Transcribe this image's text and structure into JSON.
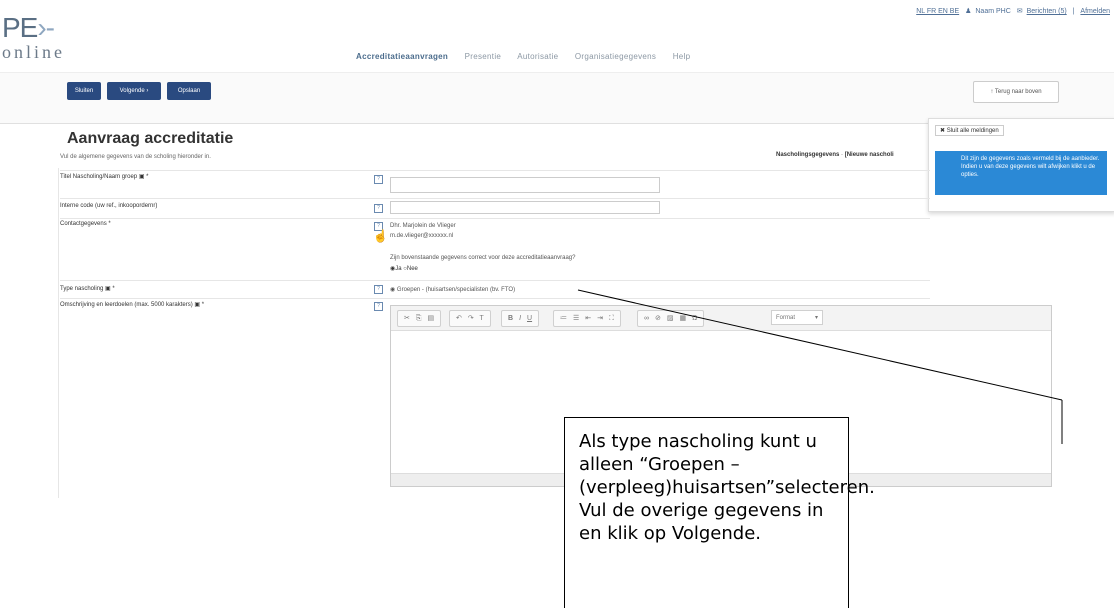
{
  "logo": {
    "line1": "PE",
    "arrow": "›-",
    "line2": "online"
  },
  "top_links": {
    "langs": "NL FR EN BE",
    "user": "Naam PHC",
    "messages": "Berichten (5)",
    "logout": "Afmelden"
  },
  "nav": {
    "items": [
      "Accreditatieaanvragen",
      "Presentie",
      "Autorisatie",
      "Organisatiegegevens",
      "Help"
    ],
    "active": 0
  },
  "toolbar": {
    "close_label": "Sluiten",
    "next_label": "Volgende ›",
    "save_label": "Opslaan",
    "top_label": "↑ Terug naar boven"
  },
  "notifications": {
    "close_label": "Sluit alle meldingen",
    "message": "Dit zijn de gegevens zoals vermeld bij de aanbieder. Indien u van deze gegevens wilt afwijken klikt u de opties.",
    "color": "#2b89d6"
  },
  "form": {
    "title": "Aanvraag accreditatie",
    "subtitle": "Vul de algemene gegevens van de scholing hieronder in.",
    "breadcrumb_1": "Nascholingsgegevens",
    "breadcrumb_2": "[Nieuwe nascholi",
    "fields": {
      "title_label": "Titel Nascholing/Naam groep",
      "internal_label": "Interne code (uw ref., inkoopordernr)",
      "contact_label": "Contactgegevens *",
      "contact_name": "Dhr. Marjolein de Vlieger",
      "contact_email": "m.de.vlieger@xxxxxx.nl",
      "contact_question": "Zijn bovenstaande gegevens correct voor deze accreditatieaanvraag?",
      "option_yes": "Ja",
      "option_no": "Nee",
      "type_label": "Type nascholing",
      "type_value": "Groepen - (huisartsen/specialisten (bv. FTO)",
      "description_label": "Omschrijving en leerdoelen (max. 5000 karakters)",
      "format_label": "Format"
    }
  },
  "callout": {
    "text": "Als type nascholing kunt u alleen “Groepen – (verpleeg)huisartsen”selecteren. Vul de overige gegevens in en klik op Volgende."
  }
}
